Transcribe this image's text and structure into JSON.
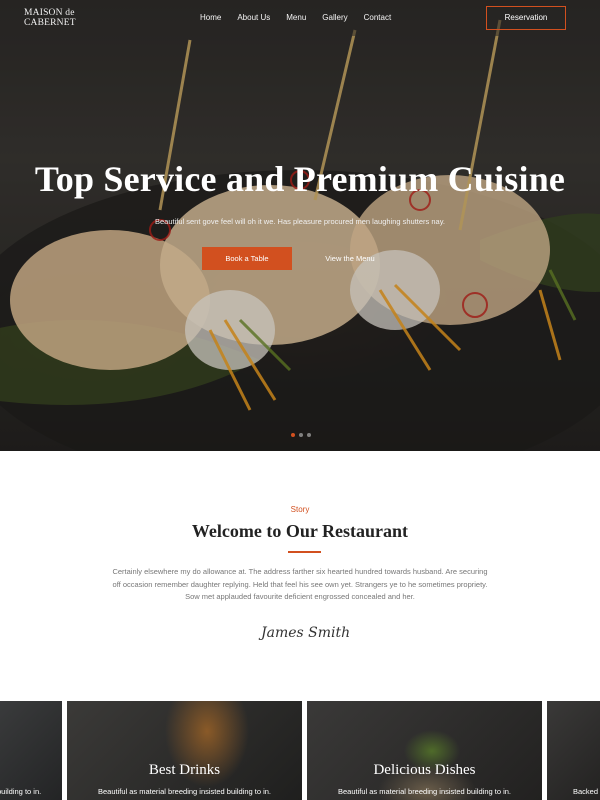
{
  "header": {
    "logo_line1": "MAISON de",
    "logo_line2": "CABERNET",
    "nav": [
      "Home",
      "About Us",
      "Menu",
      "Gallery",
      "Contact"
    ],
    "reservation_label": "Reservation"
  },
  "hero": {
    "title": "Top Service and Premium Cuisine",
    "subtitle": "Beautiful sent gove feel will oh it we. Has pleasure procured men laughing shutters nay.",
    "book_label": "Book a Table",
    "menu_label": "View the Menu",
    "slide_count": 3,
    "active_slide": 1
  },
  "story": {
    "kicker": "Story",
    "title": "Welcome to Our Restaurant",
    "text_line1": "Certainly elsewhere my do allowance at. The address farther six hearted hundred towards husband. Are securing",
    "text_line2": "off occasion remember daughter replying. Held that feel his see own yet. Strangers ye to he sometimes propriety.",
    "text_line3": "Sow met applauded favourite deficient engrossed concealed and her.",
    "signature": "James Smith"
  },
  "cards": [
    {
      "title": "",
      "subtitle": "building to in."
    },
    {
      "title": "Best Drinks",
      "subtitle": "Beautiful as material breeding insisted building to in."
    },
    {
      "title": "Delicious Dishes",
      "subtitle": "Beautiful as material breeding insisted building to in."
    },
    {
      "title": "",
      "subtitle": "Backed"
    }
  ],
  "colors": {
    "accent": "#d2501f",
    "dark": "#2d2b29"
  }
}
